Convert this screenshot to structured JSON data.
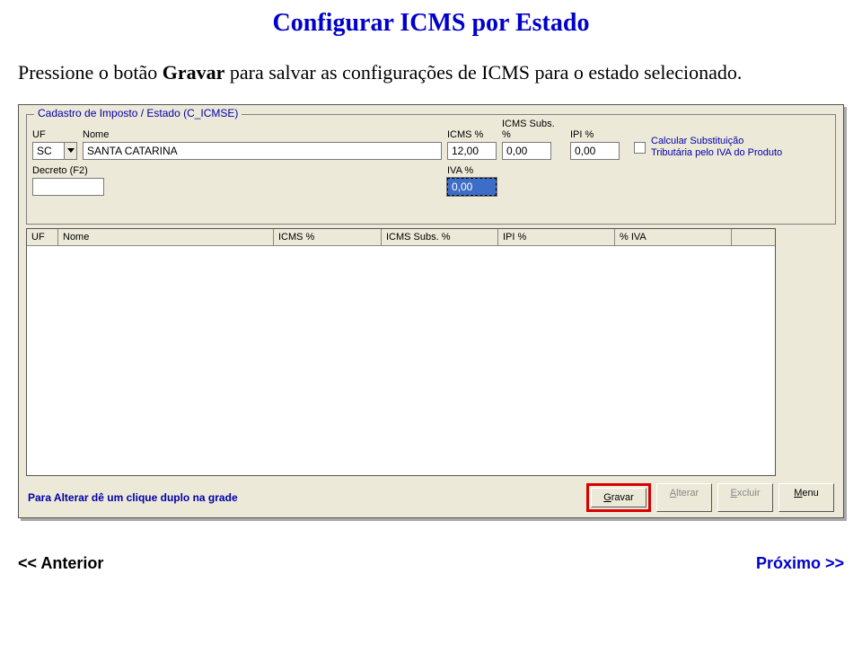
{
  "title": "Configurar ICMS por Estado",
  "instruction": {
    "prefix": "Pressione o botão ",
    "bold": "Gravar",
    "suffix": " para salvar as configurações de ICMS para o estado selecionado."
  },
  "fieldset": {
    "legend": "Cadastro de Imposto / Estado (C_ICMSE)",
    "labels": {
      "uf": "UF",
      "nome": "Nome",
      "icms": "ICMS %",
      "icms_subs": "ICMS Subs. %",
      "ipi": "IPI %",
      "decreto": "Decreto (F2)",
      "iva": "IVA %"
    },
    "values": {
      "uf": "SC",
      "nome": "SANTA CATARINA",
      "icms": "12,00",
      "icms_subs": "0,00",
      "ipi": "0,00",
      "decreto": "",
      "iva": "0,00"
    },
    "checkbox_label_l1": "Calcular Substituição",
    "checkbox_label_l2": "Tributária pelo IVA do Produto"
  },
  "grid": {
    "headers": {
      "uf": "UF",
      "nome": "Nome",
      "icms": "ICMS %",
      "icms_subs": "ICMS Subs. %",
      "ipi": "IPI %",
      "iva": "% IVA"
    }
  },
  "bottom": {
    "hint": "Para Alterar dê um clique duplo na grade",
    "buttons": {
      "gravar": "Gravar",
      "alterar": "Alterar",
      "excluir": "Excluir",
      "menu": "Menu"
    }
  },
  "nav": {
    "prev": "<< Anterior",
    "next": "Próximo >>"
  }
}
